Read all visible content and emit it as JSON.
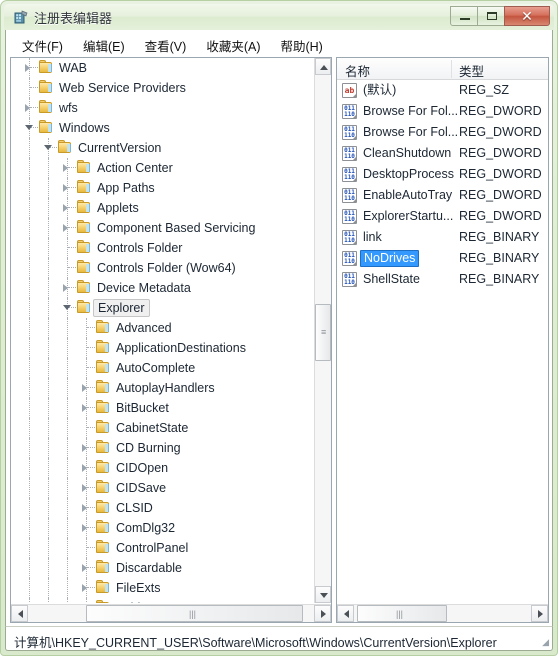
{
  "window": {
    "title": "注册表编辑器",
    "icon": "registry-editor-icon",
    "controls": {
      "minimize": "−",
      "maximize": "□",
      "close": "✕"
    }
  },
  "menu": [
    {
      "label": "文件(F)"
    },
    {
      "label": "编辑(E)"
    },
    {
      "label": "查看(V)"
    },
    {
      "label": "收藏夹(A)"
    },
    {
      "label": "帮助(H)"
    }
  ],
  "tree": {
    "items": [
      {
        "label": "WAB",
        "depth": 1,
        "state": "collapsed"
      },
      {
        "label": "Web Service Providers",
        "depth": 1,
        "state": "leaf"
      },
      {
        "label": "wfs",
        "depth": 1,
        "state": "collapsed"
      },
      {
        "label": "Windows",
        "depth": 1,
        "state": "expanded"
      },
      {
        "label": "CurrentVersion",
        "depth": 2,
        "state": "expanded"
      },
      {
        "label": "Action Center",
        "depth": 3,
        "state": "collapsed"
      },
      {
        "label": "App Paths",
        "depth": 3,
        "state": "collapsed"
      },
      {
        "label": "Applets",
        "depth": 3,
        "state": "collapsed"
      },
      {
        "label": "Component Based Servicing",
        "depth": 3,
        "state": "collapsed"
      },
      {
        "label": "Controls Folder",
        "depth": 3,
        "state": "leaf"
      },
      {
        "label": "Controls Folder (Wow64)",
        "depth": 3,
        "state": "leaf"
      },
      {
        "label": "Device Metadata",
        "depth": 3,
        "state": "collapsed"
      },
      {
        "label": "Explorer",
        "depth": 3,
        "state": "expanded",
        "selected": true
      },
      {
        "label": "Advanced",
        "depth": 4,
        "state": "leaf"
      },
      {
        "label": "ApplicationDestinations",
        "depth": 4,
        "state": "leaf"
      },
      {
        "label": "AutoComplete",
        "depth": 4,
        "state": "leaf"
      },
      {
        "label": "AutoplayHandlers",
        "depth": 4,
        "state": "collapsed"
      },
      {
        "label": "BitBucket",
        "depth": 4,
        "state": "collapsed"
      },
      {
        "label": "CabinetState",
        "depth": 4,
        "state": "leaf"
      },
      {
        "label": "CD Burning",
        "depth": 4,
        "state": "collapsed"
      },
      {
        "label": "CIDOpen",
        "depth": 4,
        "state": "collapsed"
      },
      {
        "label": "CIDSave",
        "depth": 4,
        "state": "collapsed"
      },
      {
        "label": "CLSID",
        "depth": 4,
        "state": "collapsed"
      },
      {
        "label": "ComDlg32",
        "depth": 4,
        "state": "collapsed"
      },
      {
        "label": "ControlPanel",
        "depth": 4,
        "state": "leaf"
      },
      {
        "label": "Discardable",
        "depth": 4,
        "state": "collapsed"
      },
      {
        "label": "FileExts",
        "depth": 4,
        "state": "collapsed"
      },
      {
        "label": "FolderTypes",
        "depth": 4,
        "state": "collapsed"
      }
    ]
  },
  "listview": {
    "columns": [
      {
        "label": "名称"
      },
      {
        "label": "类型"
      }
    ],
    "rows": [
      {
        "name": "(默认)",
        "type": "REG_SZ",
        "icon": "string-value-icon"
      },
      {
        "name": "Browse For Fol...",
        "type": "REG_DWORD",
        "icon": "binary-value-icon"
      },
      {
        "name": "Browse For Fol...",
        "type": "REG_DWORD",
        "icon": "binary-value-icon"
      },
      {
        "name": "CleanShutdown",
        "type": "REG_DWORD",
        "icon": "binary-value-icon"
      },
      {
        "name": "DesktopProcess",
        "type": "REG_DWORD",
        "icon": "binary-value-icon"
      },
      {
        "name": "EnableAutoTray",
        "type": "REG_DWORD",
        "icon": "binary-value-icon"
      },
      {
        "name": "ExplorerStartu...",
        "type": "REG_DWORD",
        "icon": "binary-value-icon"
      },
      {
        "name": "link",
        "type": "REG_BINARY",
        "icon": "binary-value-icon"
      },
      {
        "name": "NoDrives",
        "type": "REG_BINARY",
        "icon": "binary-value-icon",
        "selected": true
      },
      {
        "name": "ShellState",
        "type": "REG_BINARY",
        "icon": "binary-value-icon"
      }
    ]
  },
  "statusbar": {
    "path": "计算机\\HKEY_CURRENT_USER\\Software\\Microsoft\\Windows\\CurrentVersion\\Explorer"
  },
  "colors": {
    "selection_blue": "#3399ff",
    "frame_green": "#d8eacb",
    "close_red": "#c4553f"
  }
}
